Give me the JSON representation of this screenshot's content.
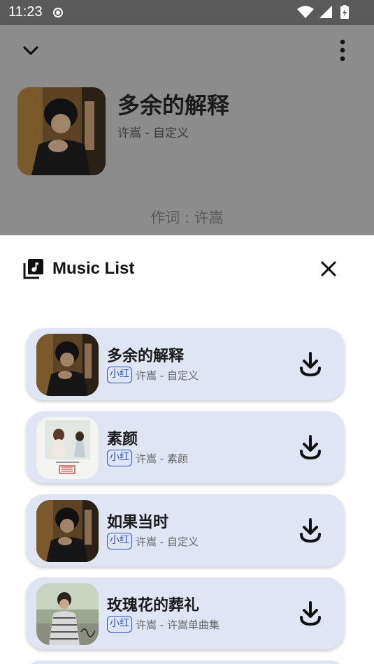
{
  "status_bar": {
    "time": "11:23"
  },
  "player": {
    "title": "多余的解释",
    "subtitle": "许嵩 - 自定义",
    "lyric": "作词 : 许嵩"
  },
  "sheet": {
    "title": "Music List",
    "songs": [
      {
        "title": "多余的解释",
        "tag": "小红",
        "meta": "许嵩 - 自定义",
        "cover": "dark-portrait"
      },
      {
        "title": "素颜",
        "tag": "小红",
        "meta": "许嵩 - 素颜",
        "cover": "light-album"
      },
      {
        "title": "如果当时",
        "tag": "小红",
        "meta": "许嵩 - 自定义",
        "cover": "dark-portrait"
      },
      {
        "title": "玫瑰花的葬礼",
        "tag": "小红",
        "meta": "许嵩 - 许嵩单曲集",
        "cover": "outdoor-portrait"
      }
    ]
  },
  "colors": {
    "card": "#dfe5f3",
    "tag": "#2f55c8",
    "dim": "#8c8c8c"
  }
}
